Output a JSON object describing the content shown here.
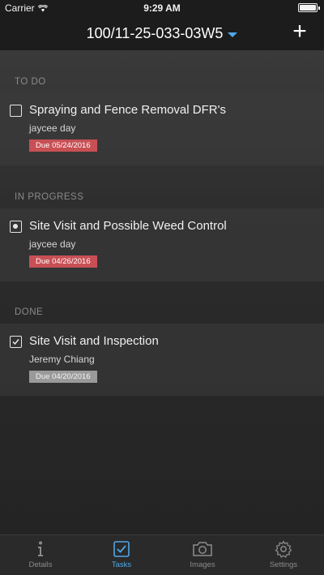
{
  "status_bar": {
    "carrier": "Carrier",
    "time": "9:29 AM"
  },
  "nav": {
    "title": "100/11-25-033-03W5",
    "add_label": "+"
  },
  "sections": [
    {
      "header": "TO DO",
      "task": {
        "title": "Spraying and Fence Removal DFR's",
        "assignee": "jaycee day",
        "due": "Due 05/24/2016",
        "status": "todo"
      }
    },
    {
      "header": "IN PROGRESS",
      "task": {
        "title": "Site Visit and Possible Weed Control",
        "assignee": "jaycee day",
        "due": "Due 04/26/2016",
        "status": "in-progress"
      }
    },
    {
      "header": "DONE",
      "task": {
        "title": "Site Visit and Inspection",
        "assignee": "Jeremy Chiang",
        "due": "Due 04/20/2016",
        "status": "done"
      }
    }
  ],
  "tabs": [
    {
      "label": "Details",
      "icon": "info-icon",
      "active": false
    },
    {
      "label": "Tasks",
      "icon": "checkbox-icon",
      "active": true
    },
    {
      "label": "Images",
      "icon": "camera-icon",
      "active": false
    },
    {
      "label": "Settings",
      "icon": "gear-icon",
      "active": false
    }
  ],
  "colors": {
    "accent": "#4fa8e8",
    "due_red": "#c85055",
    "due_gray": "#9a9a9a"
  }
}
